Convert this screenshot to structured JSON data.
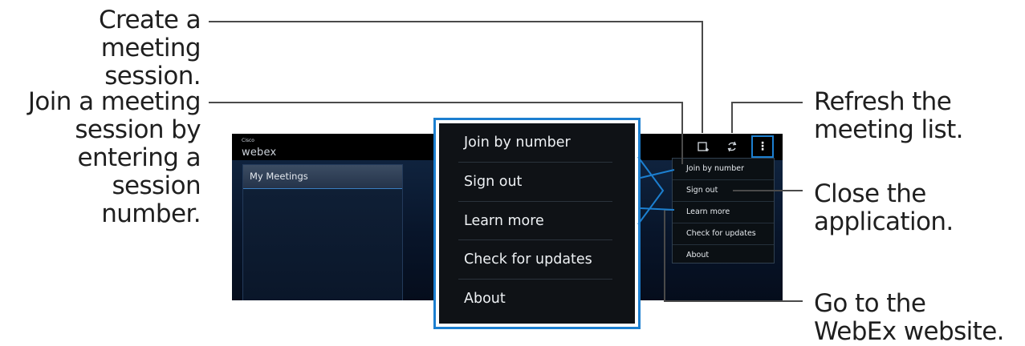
{
  "callouts": {
    "create": "Create a meeting session.",
    "join": "Join a meeting session by entering a session number.",
    "refresh": "Refresh the meeting list.",
    "close": "Close the application.",
    "website": "Go to the WebEx website."
  },
  "app": {
    "logo_top": "Cisco",
    "logo_main": "webex",
    "panel_title": "My Meetings"
  },
  "icons": {
    "create": "create-meeting-icon",
    "refresh": "refresh-icon",
    "overflow": "overflow-menu-icon"
  },
  "menu": {
    "items": [
      "Join by number",
      "Sign out",
      "Learn more",
      "Check for updates",
      "About"
    ]
  },
  "colors": {
    "highlight": "#1c7fd0",
    "leader_line": "#4a4a4a"
  }
}
